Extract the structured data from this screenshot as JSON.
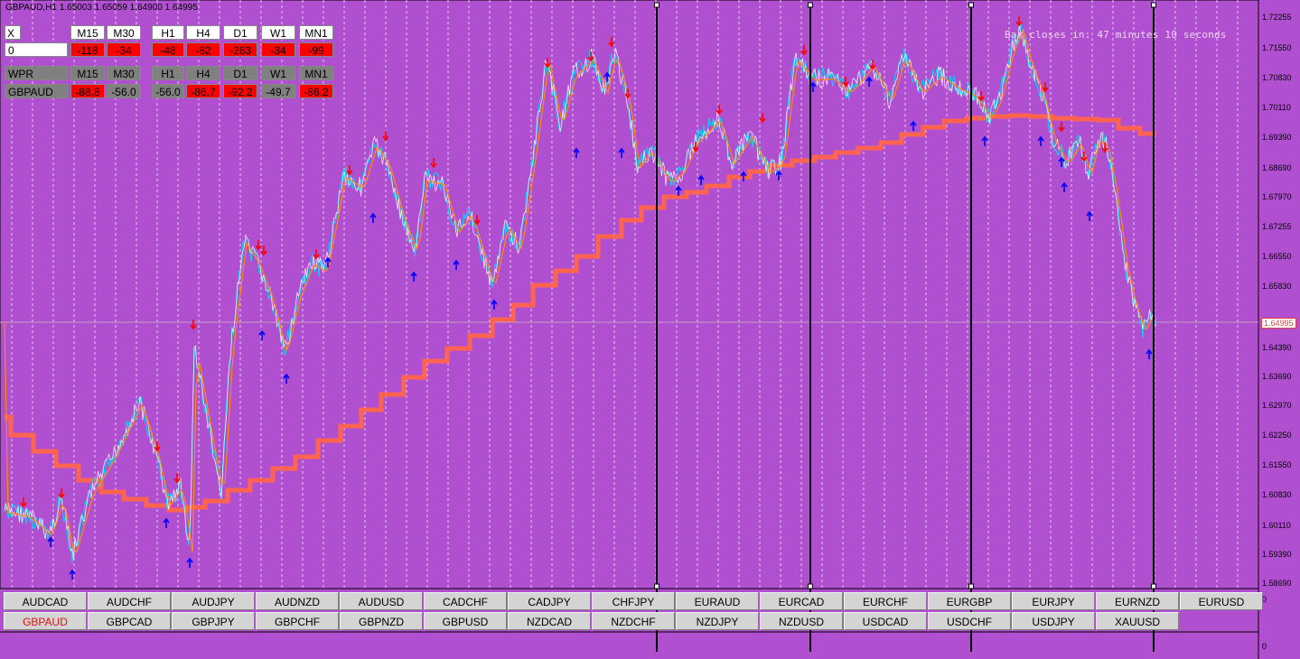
{
  "window": {
    "title": "GBPAUD,H1  1.65003 1.65059 1.64900 1.64995"
  },
  "timer": {
    "text": "Bar closes in: 47 minutes 10 seconds"
  },
  "panel1": {
    "corner": "X",
    "value": "0",
    "headers": [
      "M15",
      "M30",
      "H1",
      "H4",
      "D1",
      "W1",
      "MN1"
    ],
    "values": [
      "-118",
      "-34",
      "-48",
      "-82",
      "-263",
      "-34",
      "-99"
    ]
  },
  "panel2": {
    "corner": "WPR",
    "symbol": "GBPAUD",
    "headers": [
      "M15",
      "M30",
      "H1",
      "H4",
      "D1",
      "W1",
      "MN1"
    ],
    "values": [
      "-88.8",
      "-56.0",
      "-56.0",
      "-86.7",
      "-92.2",
      "-49.7",
      "-86.2"
    ],
    "styles": [
      "red",
      "gray",
      "gray",
      "red",
      "red",
      "gray",
      "red"
    ]
  },
  "price_axis": {
    "labels": [
      "1.72255",
      "1.71550",
      "1.70830",
      "1.70110",
      "1.69390",
      "1.68690",
      "1.67970",
      "1.67255",
      "1.66550",
      "1.65830",
      "1.64390",
      "1.63690",
      "1.62970",
      "1.62250",
      "1.61550",
      "1.60830",
      "1.60110",
      "1.59390",
      "1.58690"
    ],
    "current": "1.64995",
    "indicator_ticks": [
      "0",
      "0"
    ]
  },
  "symbols_row1": [
    "AUDCAD",
    "AUDCHF",
    "AUDJPY",
    "AUDNZD",
    "AUDUSD",
    "CADCHF",
    "CADJPY",
    "CHFJPY",
    "EURAUD",
    "EURCAD",
    "EURCHF",
    "EURGBP",
    "EURJPY",
    "EURNZD",
    "EURUSD"
  ],
  "symbols_row2": [
    "GBPAUD",
    "GBPCAD",
    "GBPJPY",
    "GBPCHF",
    "GBPNZD",
    "GBPUSD",
    "NZDCAD",
    "NZDCHF",
    "NZDJPY",
    "NZDUSD",
    "USDCAD",
    "USDCHF",
    "USDJPY",
    "XAUUSD"
  ],
  "active_symbol": "GBPAUD",
  "colors": {
    "background": "#b04fd0",
    "price_line_a": "#ffffff",
    "price_line_b": "#00d8ff",
    "signal_line": "#ff8c00",
    "ma_line": "#ff6450",
    "arrow_down": "#ff0000",
    "arrow_up": "#0000ff"
  }
}
